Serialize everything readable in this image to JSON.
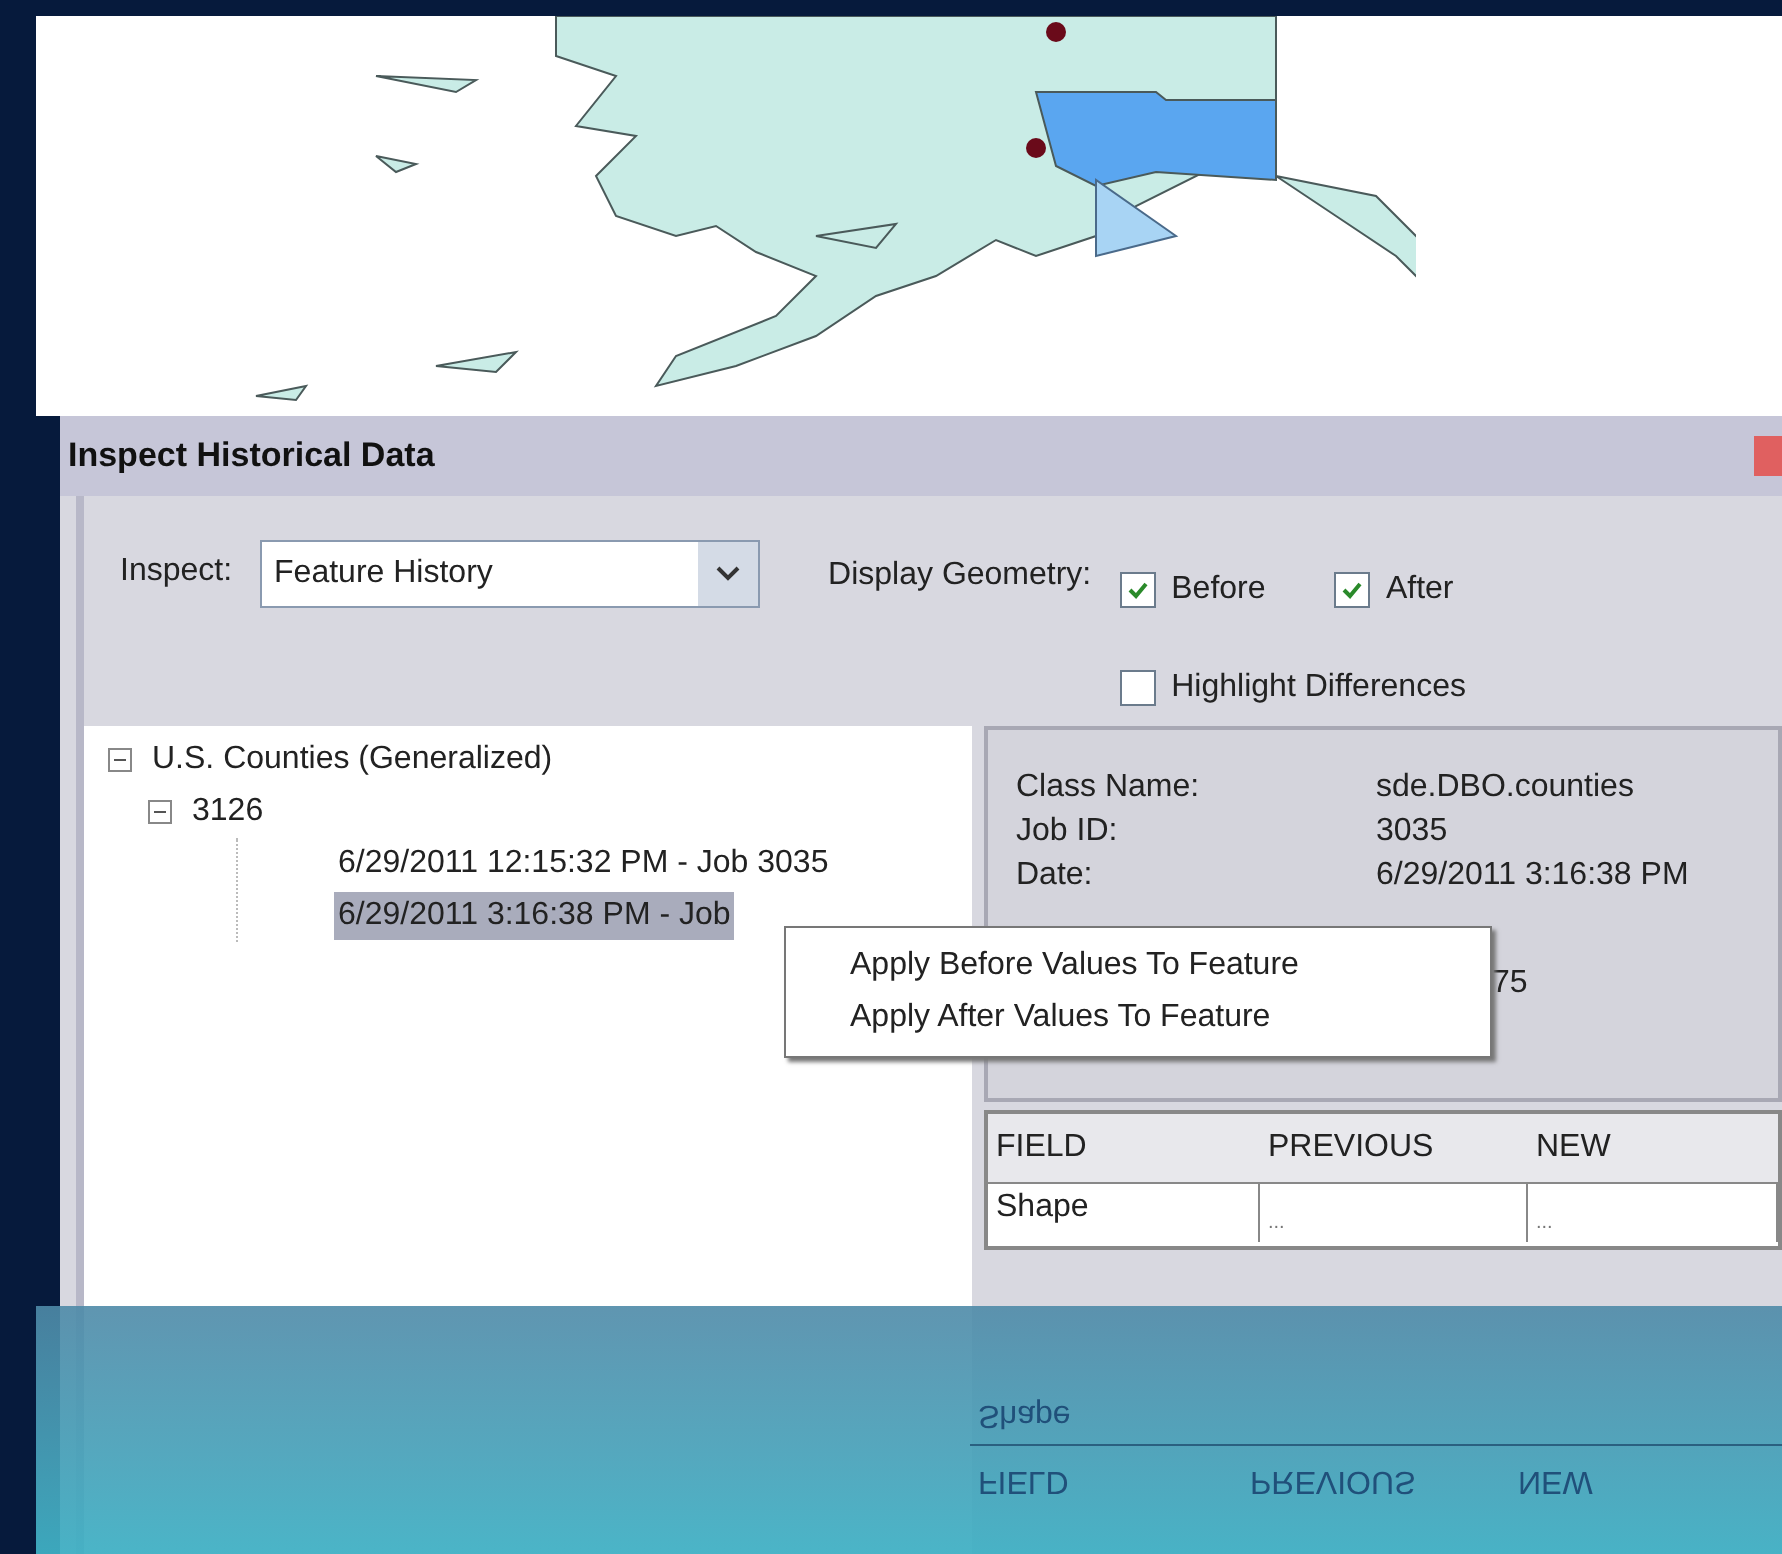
{
  "dialog": {
    "title": "Inspect Historical Data"
  },
  "inspect": {
    "label": "Inspect:",
    "value": "Feature History"
  },
  "display_geometry": {
    "label": "Display Geometry:",
    "options": [
      {
        "label": "Before",
        "checked": true
      },
      {
        "label": "After",
        "checked": true
      },
      {
        "label": "Highlight Differences",
        "checked": false
      }
    ]
  },
  "tree": {
    "items": [
      {
        "label": "U.S. Counties (Generalized)",
        "expanded": true,
        "children": [
          {
            "label": "3126",
            "expanded": true,
            "children": [
              {
                "label": "6/29/2011 12:15:32 PM - Job 3035",
                "selected": false
              },
              {
                "label": "6/29/2011 3:16:38 PM - Job",
                "selected": true
              }
            ]
          }
        ]
      }
    ]
  },
  "details": [
    {
      "label": "Class Name:",
      "value": "sde.DBO.counties"
    },
    {
      "label": "Job ID:",
      "value": "3035"
    },
    {
      "label": "Date:",
      "value": "6/29/2011 3:16:38 PM"
    },
    {
      "value": "75"
    }
  ],
  "context_menu": [
    "Apply Before Values To Feature",
    "Apply After Values To Feature"
  ],
  "table": {
    "columns": [
      "FIELD",
      "PREVIOUS",
      "NEW"
    ],
    "rows": [
      [
        "Shape",
        "...",
        "..."
      ]
    ]
  },
  "reflection": {
    "columns": [
      "FIELD",
      "PREVIOUS",
      "NEW"
    ],
    "row": [
      "Shape"
    ]
  }
}
